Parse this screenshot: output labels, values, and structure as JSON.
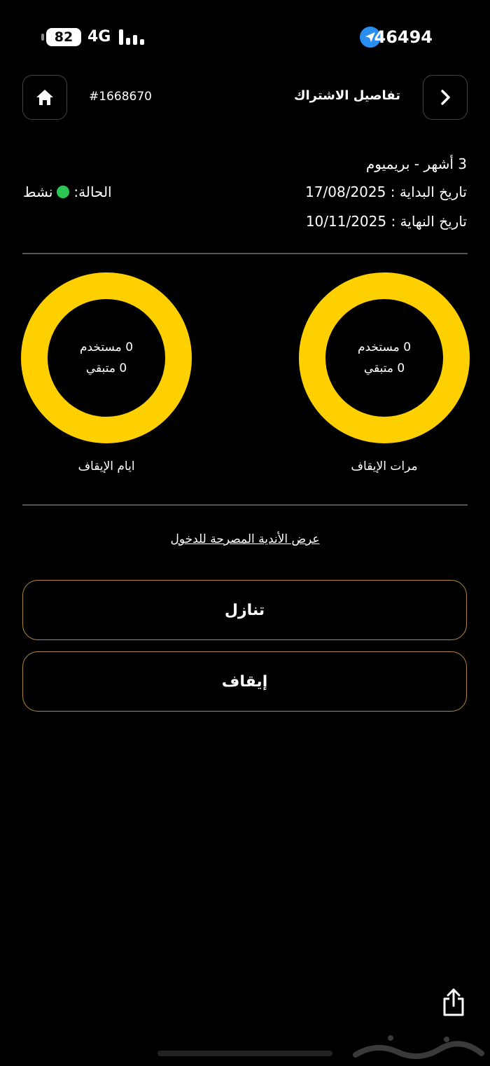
{
  "status_bar": {
    "battery": "82",
    "network": "4G",
    "time": "46494"
  },
  "header": {
    "title": "تفاصيل الاشتراك",
    "subscription_id": "#1668670"
  },
  "subscription": {
    "plan": "3 أشهر - بريميوم",
    "start_date": "تاريخ البداية : 17/08/2025",
    "end_date": "تاريخ النهاية : 10/11/2025",
    "status_label": "الحالة:",
    "status_value": "نشط",
    "status_color": "#2bc653"
  },
  "rings": [
    {
      "label": "مرات الإيقاف",
      "used": "0 مستخدم",
      "remaining": "0 متبقي",
      "color": "#ffd000"
    },
    {
      "label": "ايام الإيقاف",
      "used": "0 مستخدم",
      "remaining": "0 متبقي",
      "color": "#ffd000"
    }
  ],
  "links": {
    "clubs": "عرض الأندية المصرحة للدخول"
  },
  "actions": {
    "transfer": "تنازل",
    "pause": "إيقاف"
  },
  "icons": {
    "home": "home-icon",
    "back": "chevron-right-icon",
    "share": "share-icon",
    "location": "location-arrow-icon"
  },
  "colors": {
    "accent": "#ffd000",
    "button_border": "#b08a3a"
  }
}
